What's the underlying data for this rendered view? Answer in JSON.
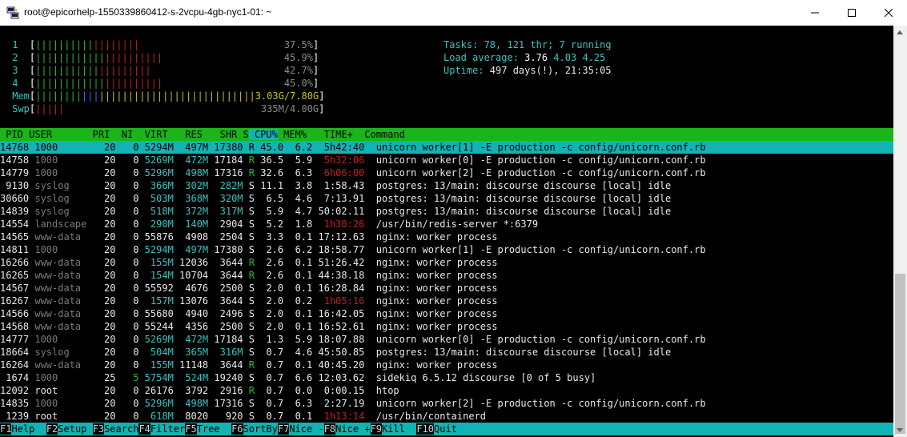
{
  "window": {
    "title": "root@epicorhelp-1550339860412-s-2vcpu-4gb-nyc1-01: ~"
  },
  "meters": {
    "cpus": [
      {
        "label": "1",
        "bar_pct": 37.5,
        "pct_text": "37.5%"
      },
      {
        "label": "2",
        "bar_pct": 45.9,
        "pct_text": "45.9%"
      },
      {
        "label": "3",
        "bar_pct": 42.7,
        "pct_text": "42.7%"
      },
      {
        "label": "4",
        "bar_pct": 45.0,
        "pct_text": "45.0%"
      }
    ],
    "mem": {
      "label": "Mem",
      "value": "3.03G/7.80G"
    },
    "swp": {
      "label": "Swp",
      "value": "335M/4.00G"
    }
  },
  "summary": {
    "tasks_label": "Tasks: ",
    "tasks": "78",
    "thr_sep": ", ",
    "thr": "121",
    "thr_label": " thr; ",
    "running": "7",
    "running_label": " running",
    "load_label": "Load average: ",
    "load1": "3.76",
    "load5": "4.03",
    "load15": "4.25",
    "uptime_label": "Uptime: ",
    "uptime_value": "497 days(!), 21:35:05"
  },
  "columns": [
    " PID",
    " USER      ",
    " PRI",
    "  NI",
    "  VIRT",
    "   RES",
    "   SHR",
    " S",
    " CPU%",
    " MEM%",
    "   TIME+ ",
    " Command"
  ],
  "processes": [
    {
      "pid": "14768",
      "user": "1000",
      "pri": "20",
      "ni": "0",
      "virt": "5294M",
      "res": "497M",
      "shr": "17380",
      "s": "R",
      "cpu": "45.0",
      "mem": "6.2",
      "time": "5h42:40",
      "cmd": "unicorn worker[1] -E production -c config/unicorn.conf.rb",
      "selected": true
    },
    {
      "pid": "14758",
      "user": "1000",
      "pri": "20",
      "ni": "0",
      "virt": "5269M",
      "res": "472M",
      "shr": "17184",
      "s": "R",
      "cpu": "36.5",
      "mem": "5.9",
      "time": "5h32:06",
      "cmd": "unicorn worker[0] -E production -c config/unicorn.conf.rb"
    },
    {
      "pid": "14779",
      "user": "1000",
      "pri": "20",
      "ni": "0",
      "virt": "5296M",
      "res": "498M",
      "shr": "17316",
      "s": "R",
      "cpu": "32.6",
      "mem": "6.3",
      "time": "6h06:00",
      "cmd": "unicorn worker[2] -E production -c config/unicorn.conf.rb"
    },
    {
      "pid": "9130",
      "user": "syslog",
      "pri": "20",
      "ni": "0",
      "virt": "366M",
      "res": "302M",
      "shr": "282M",
      "s": "S",
      "cpu": "11.1",
      "mem": "3.8",
      "time": "1:58.43",
      "cmd": "postgres: 13/main: discourse discourse [local] idle"
    },
    {
      "pid": "30660",
      "user": "syslog",
      "pri": "20",
      "ni": "0",
      "virt": "503M",
      "res": "368M",
      "shr": "320M",
      "s": "S",
      "cpu": "6.5",
      "mem": "4.6",
      "time": "7:13.91",
      "cmd": "postgres: 13/main: discourse discourse [local] idle"
    },
    {
      "pid": "14839",
      "user": "syslog",
      "pri": "20",
      "ni": "0",
      "virt": "518M",
      "res": "372M",
      "shr": "317M",
      "s": "S",
      "cpu": "5.9",
      "mem": "4.7",
      "time": "50:02.11",
      "cmd": "postgres: 13/main: discourse discourse [local] idle"
    },
    {
      "pid": "14554",
      "user": "landscape",
      "pri": "20",
      "ni": "0",
      "virt": "290M",
      "res": "140M",
      "shr": "2904",
      "s": "S",
      "cpu": "5.2",
      "mem": "1.8",
      "time": "1h30:26",
      "cmd": "/usr/bin/redis-server *:6379"
    },
    {
      "pid": "14565",
      "user": "www-data",
      "pri": "20",
      "ni": "0",
      "virt": "55876",
      "res": "4908",
      "shr": "2504",
      "s": "S",
      "cpu": "3.3",
      "mem": "0.1",
      "time": "17:12.63",
      "cmd": "nginx: worker process"
    },
    {
      "pid": "14811",
      "user": "1000",
      "pri": "20",
      "ni": "0",
      "virt": "5294M",
      "res": "497M",
      "shr": "17380",
      "s": "S",
      "cpu": "2.6",
      "mem": "6.2",
      "time": "18:58.77",
      "cmd": "unicorn worker[1] -E production -c config/unicorn.conf.rb"
    },
    {
      "pid": "16266",
      "user": "www-data",
      "pri": "20",
      "ni": "0",
      "virt": "155M",
      "res": "12036",
      "shr": "3644",
      "s": "R",
      "cpu": "2.6",
      "mem": "0.1",
      "time": "51:26.42",
      "cmd": "nginx: worker process"
    },
    {
      "pid": "16265",
      "user": "www-data",
      "pri": "20",
      "ni": "0",
      "virt": "154M",
      "res": "10704",
      "shr": "3644",
      "s": "R",
      "cpu": "2.6",
      "mem": "0.1",
      "time": "44:38.18",
      "cmd": "nginx: worker process"
    },
    {
      "pid": "14567",
      "user": "www-data",
      "pri": "20",
      "ni": "0",
      "virt": "55592",
      "res": "4676",
      "shr": "2500",
      "s": "S",
      "cpu": "2.0",
      "mem": "0.1",
      "time": "16:28.84",
      "cmd": "nginx: worker process"
    },
    {
      "pid": "16267",
      "user": "www-data",
      "pri": "20",
      "ni": "0",
      "virt": "157M",
      "res": "13076",
      "shr": "3644",
      "s": "S",
      "cpu": "2.0",
      "mem": "0.2",
      "time": "1h05:16",
      "cmd": "nginx: worker process"
    },
    {
      "pid": "14566",
      "user": "www-data",
      "pri": "20",
      "ni": "0",
      "virt": "55680",
      "res": "4940",
      "shr": "2496",
      "s": "S",
      "cpu": "2.0",
      "mem": "0.1",
      "time": "16:42.05",
      "cmd": "nginx: worker process"
    },
    {
      "pid": "14568",
      "user": "www-data",
      "pri": "20",
      "ni": "0",
      "virt": "55244",
      "res": "4356",
      "shr": "2500",
      "s": "S",
      "cpu": "2.0",
      "mem": "0.1",
      "time": "16:52.61",
      "cmd": "nginx: worker process"
    },
    {
      "pid": "14777",
      "user": "1000",
      "pri": "20",
      "ni": "0",
      "virt": "5269M",
      "res": "472M",
      "shr": "17184",
      "s": "S",
      "cpu": "1.3",
      "mem": "5.9",
      "time": "18:07.88",
      "cmd": "unicorn worker[0] -E production -c config/unicorn.conf.rb"
    },
    {
      "pid": "18664",
      "user": "syslog",
      "pri": "20",
      "ni": "0",
      "virt": "504M",
      "res": "365M",
      "shr": "316M",
      "s": "S",
      "cpu": "0.7",
      "mem": "4.6",
      "time": "45:50.85",
      "cmd": "postgres: 13/main: discourse discourse [local] idle"
    },
    {
      "pid": "16264",
      "user": "www-data",
      "pri": "20",
      "ni": "0",
      "virt": "155M",
      "res": "11148",
      "shr": "3644",
      "s": "R",
      "cpu": "0.7",
      "mem": "0.1",
      "time": "40:45.20",
      "cmd": "nginx: worker process"
    },
    {
      "pid": "1674",
      "user": "1000",
      "pri": "25",
      "ni": "5",
      "virt": "5754M",
      "res": "524M",
      "shr": "19240",
      "s": "S",
      "cpu": "0.7",
      "mem": "6.6",
      "time": "12:03.62",
      "cmd": "sidekiq 6.5.12 discourse [0 of 5 busy]"
    },
    {
      "pid": "12092",
      "user": "root",
      "pri": "20",
      "ni": "0",
      "virt": "26176",
      "res": "3792",
      "shr": "2916",
      "s": "R",
      "cpu": "0.7",
      "mem": "0.0",
      "time": "0:00.15",
      "cmd": "htop"
    },
    {
      "pid": "14835",
      "user": "1000",
      "pri": "20",
      "ni": "0",
      "virt": "5296M",
      "res": "498M",
      "shr": "17316",
      "s": "S",
      "cpu": "0.7",
      "mem": "6.3",
      "time": "2:27.19",
      "cmd": "unicorn worker[2] -E production -c config/unicorn.conf.rb"
    },
    {
      "pid": "1239",
      "user": "root",
      "pri": "20",
      "ni": "0",
      "virt": "618M",
      "res": "8020",
      "shr": "920",
      "s": "S",
      "cpu": "0.7",
      "mem": "0.1",
      "time": "1h13:14",
      "cmd": "/usr/bin/containerd"
    }
  ],
  "fkeys": [
    {
      "num": "F1",
      "label": "Help  "
    },
    {
      "num": "F2",
      "label": "Setup "
    },
    {
      "num": "F3",
      "label": "Search"
    },
    {
      "num": "F4",
      "label": "Filter"
    },
    {
      "num": "F5",
      "label": "Tree  "
    },
    {
      "num": "F6",
      "label": "SortBy"
    },
    {
      "num": "F7",
      "label": "Nice -"
    },
    {
      "num": "F8",
      "label": "Nice +"
    },
    {
      "num": "F9",
      "label": "Kill  "
    },
    {
      "num": "F10",
      "label": "Quit  "
    }
  ],
  "colors": {
    "header_bg": "#19b519",
    "selected_bg": "#12b3b3",
    "label_cyan": "#3bc3c3"
  }
}
